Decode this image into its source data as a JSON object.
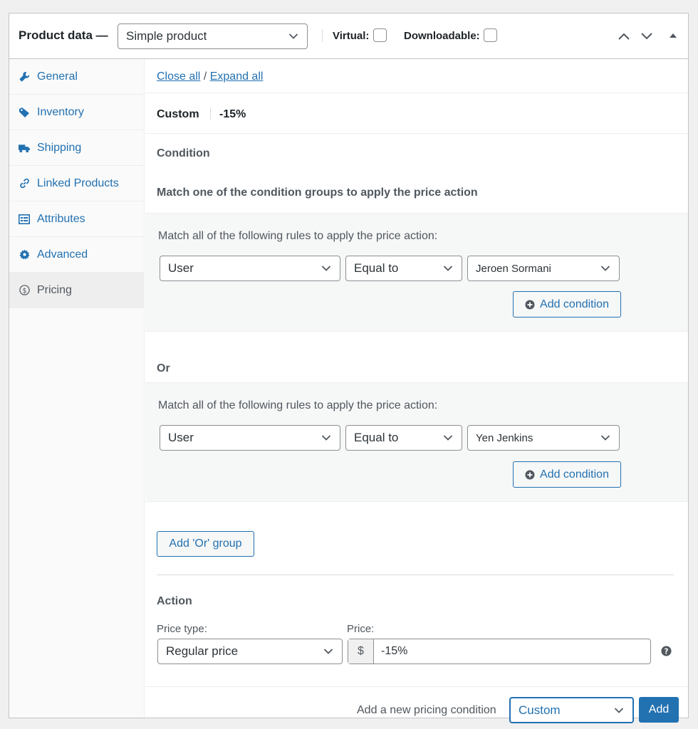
{
  "header": {
    "title": "Product data —",
    "product_type": "Simple product",
    "virtual_label": "Virtual:",
    "downloadable_label": "Downloadable:"
  },
  "sidebar": {
    "items": [
      {
        "label": "General",
        "icon": "wrench-icon"
      },
      {
        "label": "Inventory",
        "icon": "tag-icon"
      },
      {
        "label": "Shipping",
        "icon": "truck-icon"
      },
      {
        "label": "Linked Products",
        "icon": "link-icon"
      },
      {
        "label": "Attributes",
        "icon": "list-icon"
      },
      {
        "label": "Advanced",
        "icon": "gear-icon"
      },
      {
        "label": "Pricing",
        "icon": "dollar-circle-icon"
      }
    ],
    "active": "Pricing"
  },
  "main": {
    "close_all": "Close all",
    "separator": "/",
    "expand_all": "Expand all",
    "rule_name": "Custom",
    "rule_value": "-15%",
    "condition_heading": "Condition",
    "condition_desc": "Match one of the condition groups to apply the price action",
    "groups": [
      {
        "desc": "Match all of the following rules to apply the price action:",
        "field": "User",
        "operator": "Equal to",
        "value": "Jeroen Sormani",
        "add_label": "Add condition"
      },
      {
        "desc": "Match all of the following rules to apply the price action:",
        "field": "User",
        "operator": "Equal to",
        "value": "Yen Jenkins",
        "add_label": "Add condition"
      }
    ],
    "or_label": "Or",
    "add_or_group": "Add 'Or' group",
    "action_heading": "Action",
    "price_type_label": "Price type:",
    "price_type_value": "Regular price",
    "price_label": "Price:",
    "currency": "$",
    "price_value": "-15%",
    "add_new_label": "Add a new pricing condition",
    "new_condition_type": "Custom",
    "add_button": "Add"
  },
  "colors": {
    "link": "#2271b1",
    "primary": "#2271b1",
    "group_bg": "#f6f7f7"
  }
}
